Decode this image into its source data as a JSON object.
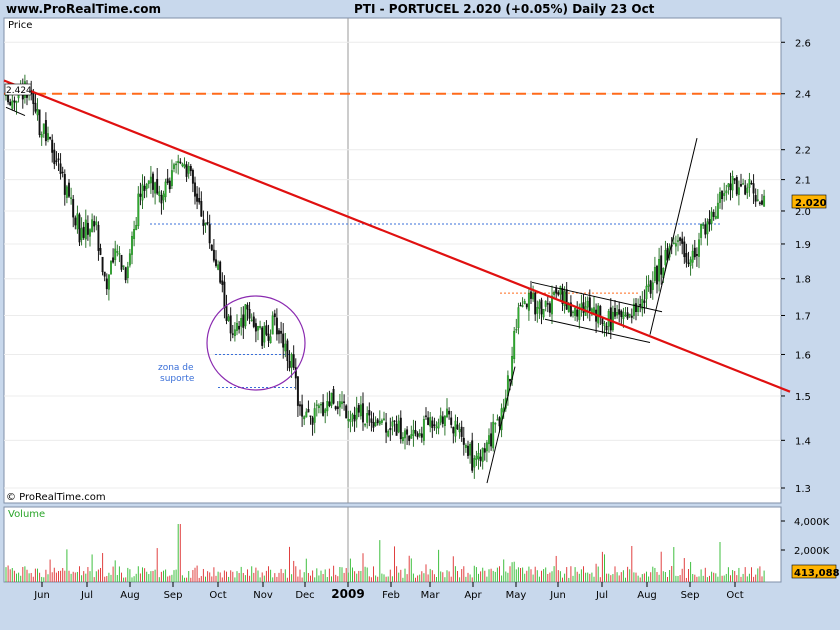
{
  "header": {
    "site": "www.ProRealTime.com",
    "title": "PTI - PORTUCEL    2.020 (+0.05%)    Daily  23 Oct"
  },
  "price_panel": {
    "label": "Price",
    "copyright": "© ProRealTime.com",
    "annotation": [
      "zona de",
      "suporte"
    ],
    "last_price_tag": "2.020",
    "top_left_tag": "2.424"
  },
  "volume_panel": {
    "label": "Volume",
    "last_volume_tag": "413,088"
  },
  "colors": {
    "up_candle": "#1a6b1a",
    "down_candle": "#000000",
    "trendline": "#e01010",
    "resistance_dashed": "#ff6a1a",
    "support_dotted": "#3a6fd8",
    "circle": "#8a2ab0",
    "volume_up": "#3fbf3f",
    "volume_down": "#e04040",
    "last_tag": "#ffb400"
  },
  "chart_data": {
    "type": "candlestick",
    "instrument": "PTI - PORTUCEL",
    "interval": "Daily",
    "last_close": 2.02,
    "change_pct": 0.05,
    "y_ticks": [
      1.3,
      1.4,
      1.5,
      1.6,
      1.7,
      1.8,
      1.9,
      2.0,
      2.1,
      2.2,
      2.4,
      2.6
    ],
    "scale": "log",
    "ylim": [
      1.27,
      2.7
    ],
    "x_ticks": [
      "Jun",
      "Jul",
      "Aug",
      "Sep",
      "Oct",
      "Nov",
      "Dec",
      "2009",
      "Feb",
      "Mar",
      "Apr",
      "May",
      "Jun",
      "Jul",
      "Aug",
      "Sep",
      "Oct"
    ],
    "close_path": [
      [
        "May-15",
        2.38
      ],
      [
        "May-30",
        2.42
      ],
      [
        "Jun-10",
        2.28
      ],
      [
        "Jun-25",
        2.18
      ],
      [
        "Jul-05",
        2.02
      ],
      [
        "Jul-15",
        1.93
      ],
      [
        "Jul-28",
        1.97
      ],
      [
        "Aug-05",
        1.78
      ],
      [
        "Aug-15",
        1.88
      ],
      [
        "Aug-28",
        1.82
      ],
      [
        "Sep-05",
        2.05
      ],
      [
        "Sep-12",
        2.12
      ],
      [
        "Sep-20",
        2.02
      ],
      [
        "Sep-28",
        2.18
      ],
      [
        "Oct-05",
        2.06
      ],
      [
        "Oct-12",
        1.95
      ],
      [
        "Oct-20",
        1.8
      ],
      [
        "Oct-28",
        1.63
      ],
      [
        "Nov-05",
        1.72
      ],
      [
        "Nov-15",
        1.64
      ],
      [
        "Nov-25",
        1.68
      ],
      [
        "Dec-02",
        1.66
      ],
      [
        "Dec-10",
        1.57
      ],
      [
        "Dec-18",
        1.44
      ],
      [
        "Dec-28",
        1.46
      ],
      [
        "Jan-08",
        1.5
      ],
      [
        "Jan-18",
        1.47
      ],
      [
        "Jan-28",
        1.46
      ],
      [
        "Feb-08",
        1.45
      ],
      [
        "Feb-18",
        1.43
      ],
      [
        "Feb-28",
        1.4
      ],
      [
        "Mar-08",
        1.44
      ],
      [
        "Mar-18",
        1.46
      ],
      [
        "Mar-28",
        1.41
      ],
      [
        "Apr-05",
        1.39
      ],
      [
        "Apr-12",
        1.35
      ],
      [
        "Apr-20",
        1.37
      ],
      [
        "Apr-28",
        1.45
      ],
      [
        "May-06",
        1.56
      ],
      [
        "May-14",
        1.7
      ],
      [
        "May-22",
        1.74
      ],
      [
        "Jun-01",
        1.72
      ],
      [
        "Jun-10",
        1.75
      ],
      [
        "Jun-20",
        1.71
      ],
      [
        "Jun-30",
        1.73
      ],
      [
        "Jul-10",
        1.69
      ],
      [
        "Jul-20",
        1.68
      ],
      [
        "Jul-30",
        1.72
      ],
      [
        "Aug-07",
        1.75
      ],
      [
        "Aug-15",
        1.81
      ],
      [
        "Aug-22",
        1.88
      ],
      [
        "Aug-30",
        1.92
      ],
      [
        "Sep-07",
        1.84
      ],
      [
        "Sep-15",
        1.94
      ],
      [
        "Sep-23",
        2.02
      ],
      [
        "Oct-01",
        2.08
      ],
      [
        "Oct-08",
        2.09
      ],
      [
        "Oct-16",
        2.07
      ],
      [
        "Oct-23",
        2.02
      ]
    ],
    "horizontal_lines": [
      {
        "style": "dashed",
        "color": "orange",
        "value": 2.4
      },
      {
        "style": "dotted",
        "color": "blue",
        "value": 1.96
      },
      {
        "style": "dotted",
        "color": "blue",
        "value": 1.6
      },
      {
        "style": "dotted",
        "color": "blue",
        "value": 1.52
      },
      {
        "style": "dotted",
        "color": "orange",
        "value": 1.76
      }
    ],
    "trendline": {
      "color": "red",
      "from": [
        "May-15",
        2.45
      ],
      "to": [
        "Oct-23 (projected)",
        1.51
      ]
    },
    "volume_ticks": [
      "4,000K",
      "2,000K"
    ],
    "last_volume": 413088
  }
}
